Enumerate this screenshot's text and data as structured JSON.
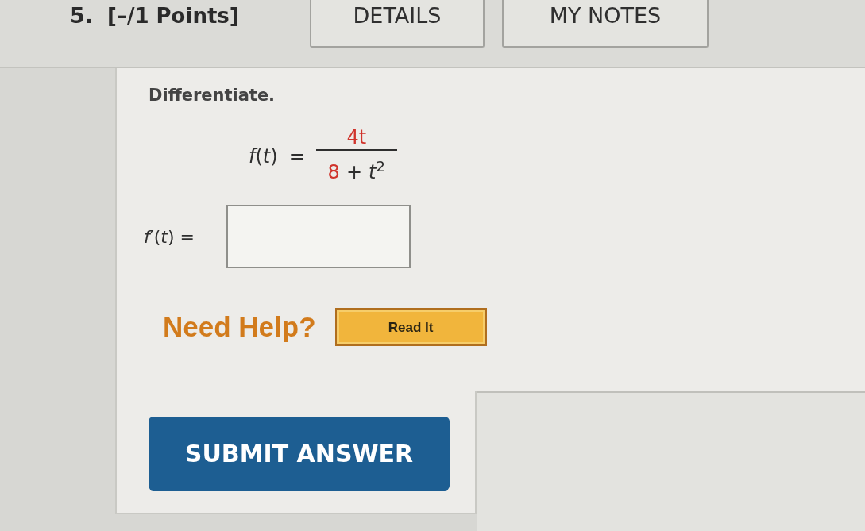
{
  "question": {
    "number": "5.",
    "points": "[–/1 Points]"
  },
  "header_buttons": [
    "DETAILS",
    "MY NOTES"
  ],
  "prompt": "Differentiate.",
  "equation": {
    "lhs": "*f*(*t*)",
    "relation": "=",
    "numerator": [
      {
        "text": "4t",
        "color": "#d0342c"
      }
    ],
    "denominator": [
      {
        "text": "8",
        "color": "#d0342c"
      },
      {
        "text": "+",
        "color": "#2e2e2e"
      },
      {
        "text": "*t*$^{2}$",
        "color": "#2e2e2e"
      }
    ]
  },
  "answer": {
    "label": "*f*′(*t*) ="
  },
  "help": {
    "label": "Need Help?",
    "buttons": [
      "Read It"
    ]
  },
  "submit": {
    "label": "SUBMIT ANSWER"
  }
}
